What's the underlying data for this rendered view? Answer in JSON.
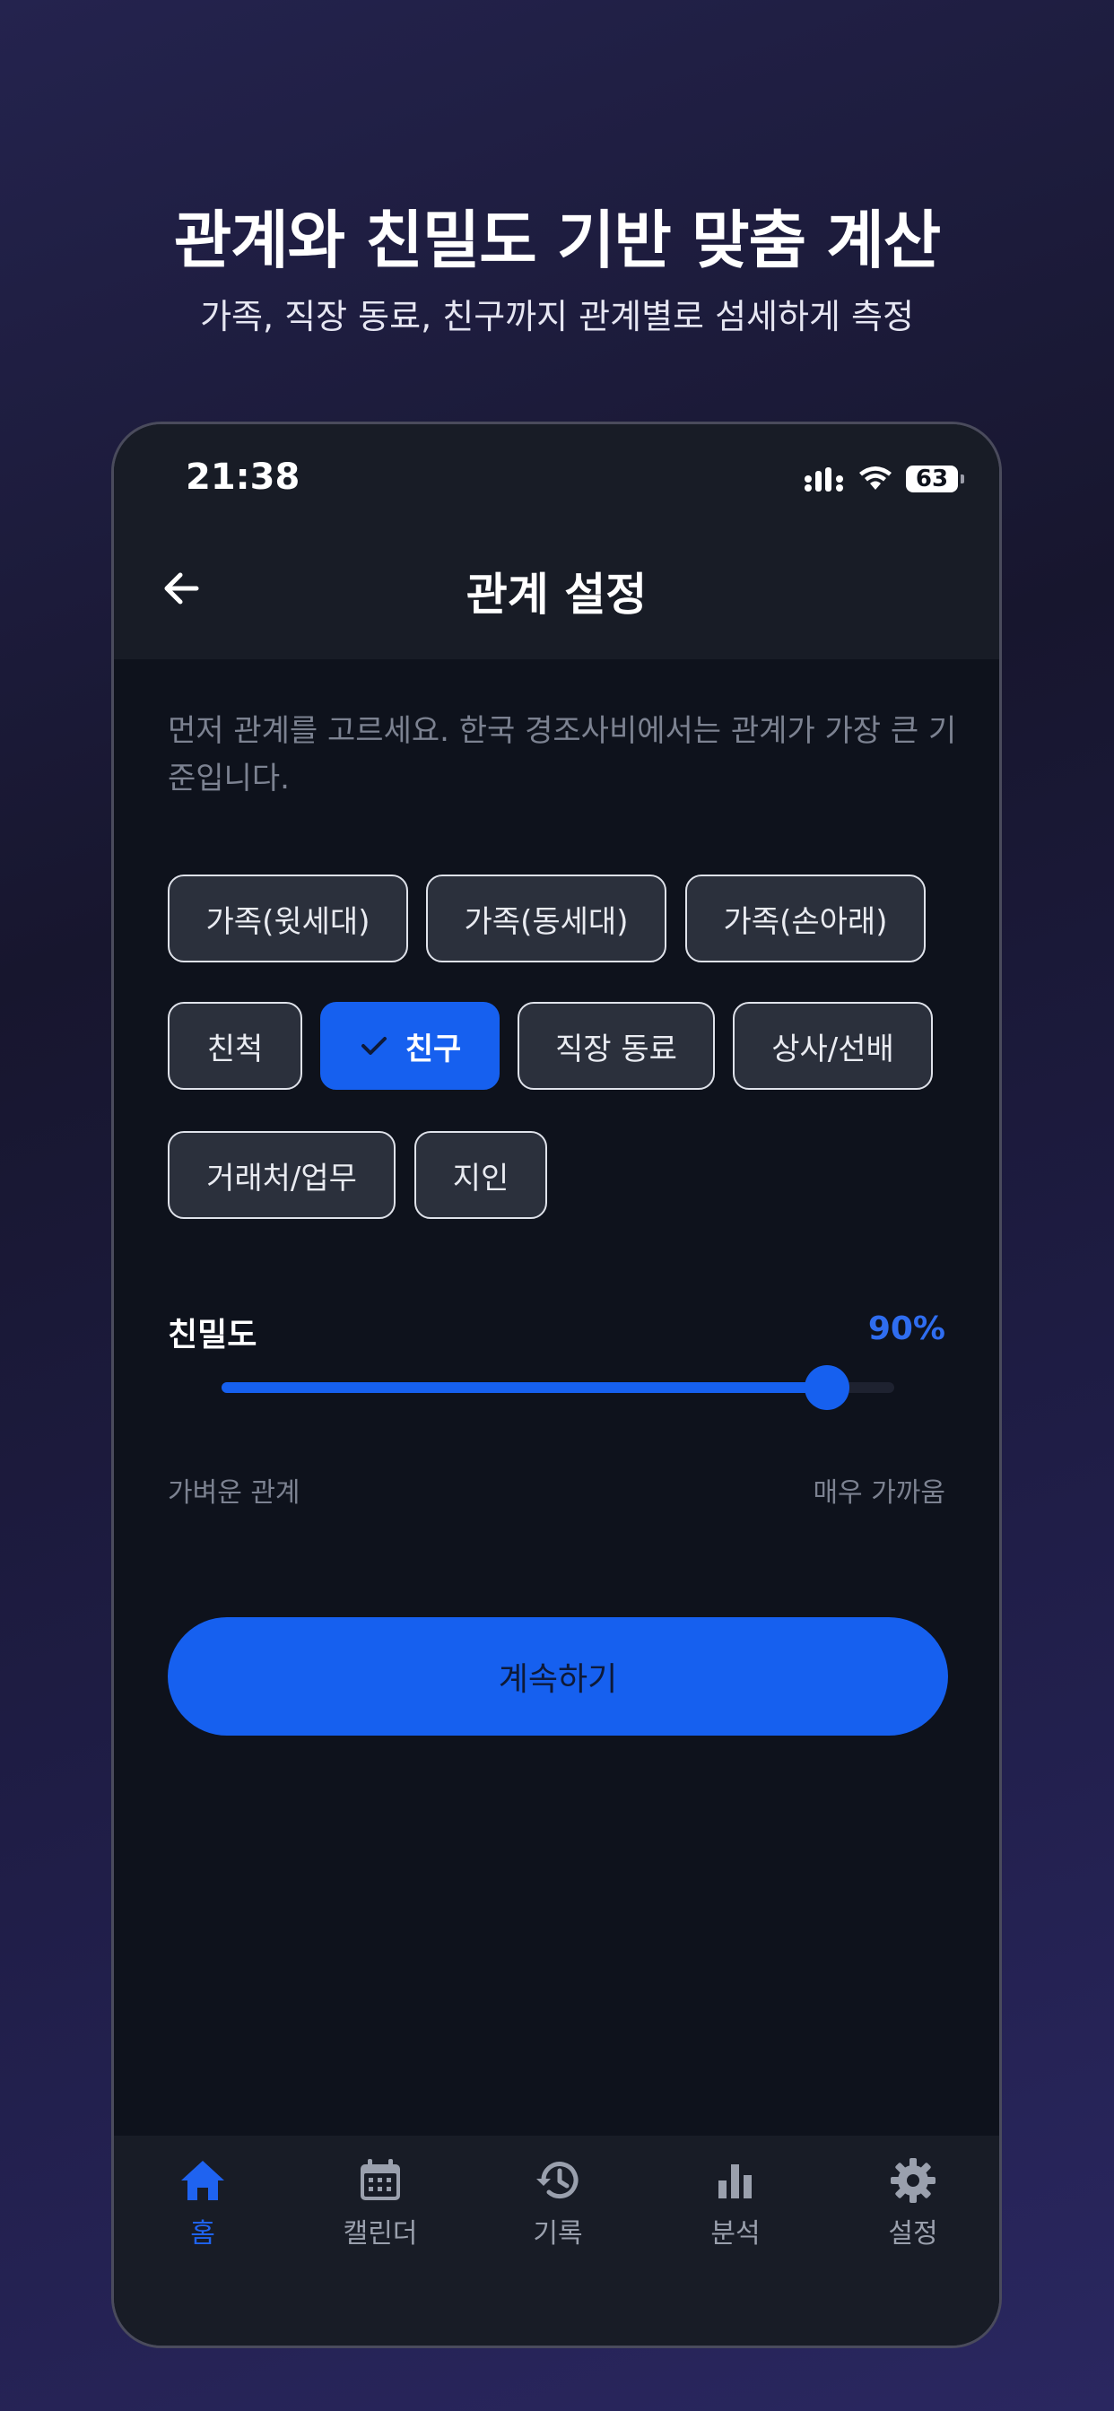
{
  "hero": {
    "title": "관계와 친밀도 기반 맞춤 계산",
    "subtitle": "가족, 직장 동료, 친구까지 관계별로 섬세하게 측정"
  },
  "status_bar": {
    "time": "21:38",
    "battery": "63"
  },
  "header": {
    "title": "관계 설정"
  },
  "intro_text": "먼저 관계를 고르세요. 한국 경조사비에서는 관계가 가장 큰 기준입니다.",
  "relationships": [
    {
      "label": "가족(윗세대)",
      "selected": false
    },
    {
      "label": "가족(동세대)",
      "selected": false
    },
    {
      "label": "가족(손아래)",
      "selected": false
    },
    {
      "label": "친척",
      "selected": false
    },
    {
      "label": "친구",
      "selected": true
    },
    {
      "label": "직장 동료",
      "selected": false
    },
    {
      "label": "상사/선배",
      "selected": false
    },
    {
      "label": "거래처/업무",
      "selected": false
    },
    {
      "label": "지인",
      "selected": false
    }
  ],
  "intimacy": {
    "label": "친밀도",
    "value_text": "90%",
    "value": 0.9,
    "min_label": "가벼운 관계",
    "max_label": "매우 가까움"
  },
  "continue_button": {
    "label": "계속하기"
  },
  "tabs": [
    {
      "label": "홈",
      "icon": "home-icon",
      "active": true
    },
    {
      "label": "캘린더",
      "icon": "calendar-icon",
      "active": false
    },
    {
      "label": "기록",
      "icon": "history-icon",
      "active": false
    },
    {
      "label": "분석",
      "icon": "bar-chart-icon",
      "active": false
    },
    {
      "label": "설정",
      "icon": "gear-icon",
      "active": false
    }
  ],
  "colors": {
    "accent": "#1660ef",
    "background": "#0e121c",
    "chip_background": "#2b303c",
    "muted_text": "#7c8291"
  }
}
